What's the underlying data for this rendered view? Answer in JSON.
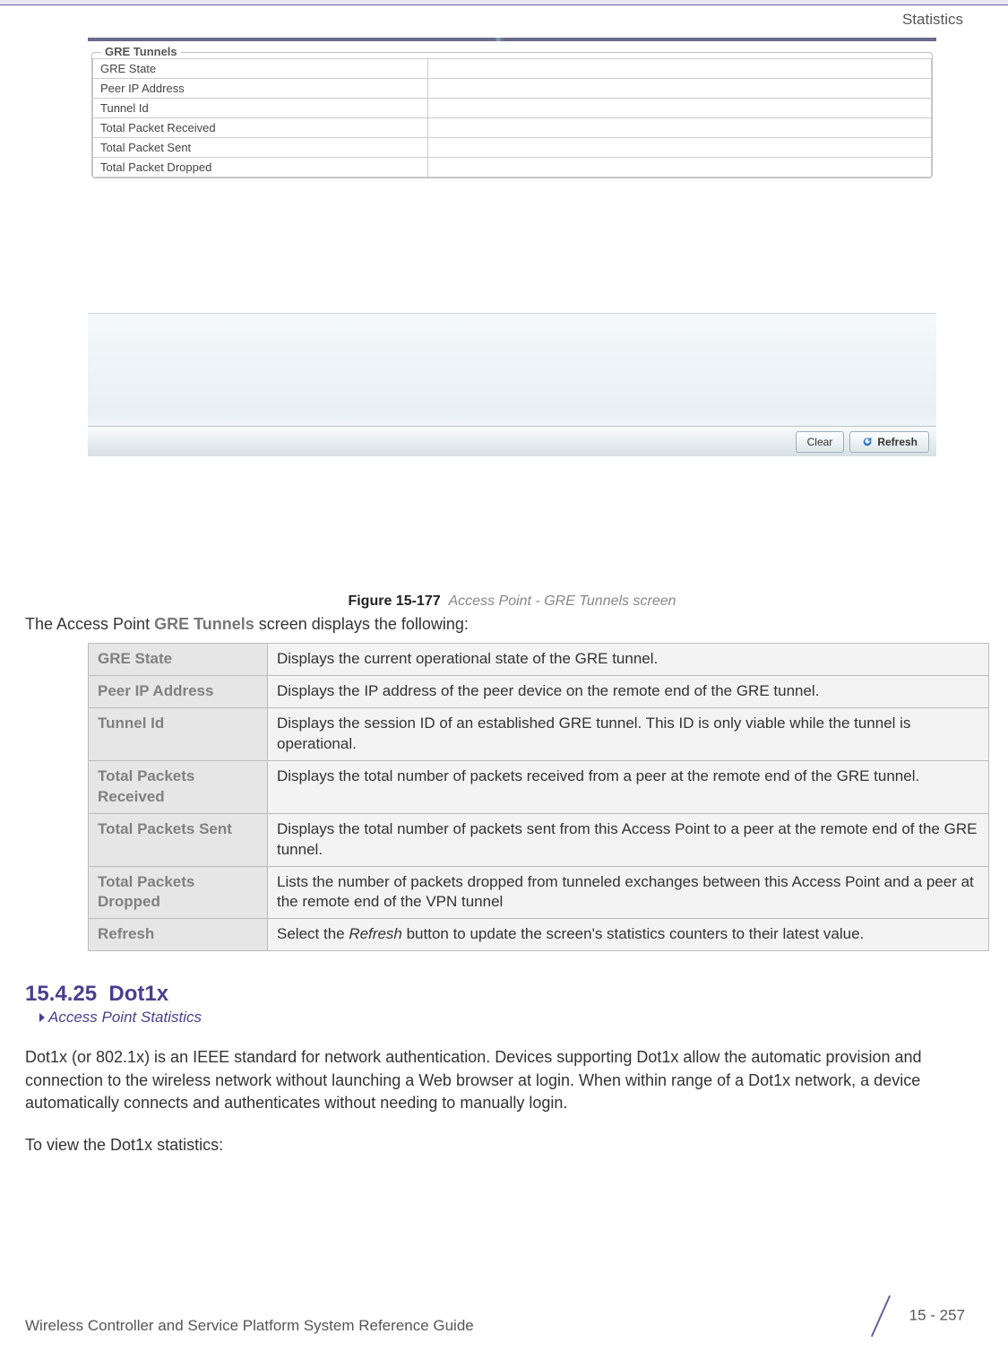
{
  "header": {
    "section": "Statistics"
  },
  "screenshot": {
    "legend": "GRE Tunnels",
    "rows": [
      "GRE State",
      "Peer IP Address",
      "Tunnel Id",
      "Total Packet Received",
      "Total Packet Sent",
      "Total Packet Dropped"
    ],
    "buttons": {
      "clear": "Clear",
      "refresh": "Refresh"
    }
  },
  "figure": {
    "label": "Figure 15-177",
    "caption": "Access Point - GRE Tunnels screen"
  },
  "intro": {
    "pre": "The Access Point ",
    "bold": "GRE Tunnels",
    "post": " screen displays the following:"
  },
  "table": [
    {
      "term": "GRE State",
      "desc": "Displays the current operational state of the GRE tunnel."
    },
    {
      "term": "Peer IP Address",
      "desc": "Displays the IP address of the peer device on the remote end of the GRE tunnel."
    },
    {
      "term": "Tunnel Id",
      "desc": "Displays the session ID of an established GRE tunnel. This ID is only viable while the tunnel is operational."
    },
    {
      "term": "Total Packets Received",
      "desc": "Displays the total number of packets received from a peer at the remote end of the GRE tunnel."
    },
    {
      "term": "Total Packets Sent",
      "desc": "Displays the total number of packets sent from this Access Point to a peer at the remote end of the GRE tunnel."
    },
    {
      "term": "Total Packets Dropped",
      "desc": "Lists the number of packets dropped from tunneled exchanges between this Access Point and a peer at the remote end of the VPN tunnel"
    },
    {
      "term": "Refresh",
      "desc_pre": "Select the ",
      "desc_ital": "Refresh",
      "desc_post": " button to update the screen's statistics counters to their latest value."
    }
  ],
  "section": {
    "number": "15.4.25",
    "title": "Dot1x",
    "breadcrumb": "Access Point Statistics"
  },
  "paragraphs": {
    "p1": "Dot1x (or 802.1x) is an IEEE standard for network authentication. Devices supporting Dot1x allow the automatic provision and connection to the wireless network without launching a Web browser at login. When within range of a Dot1x network, a device automatically connects and authenticates without needing to manually login.",
    "p2": "To view the Dot1x statistics:"
  },
  "footer": {
    "left": "Wireless Controller and Service Platform System Reference Guide",
    "right": "15 - 257"
  }
}
